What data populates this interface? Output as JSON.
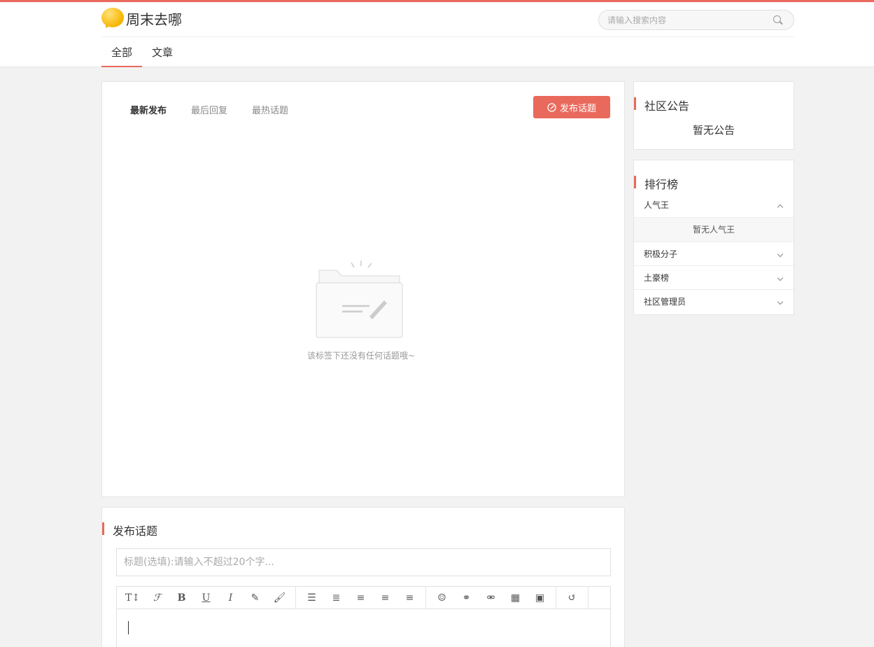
{
  "header": {
    "site_name": "周末去哪",
    "search_placeholder": "请输入搜索内容",
    "nav_tabs": [
      "全部",
      "文章"
    ]
  },
  "main": {
    "sort_tabs": [
      "最新发布",
      "最后回复",
      "最热话题"
    ],
    "post_button": "发布话题",
    "empty_message": "该标签下还没有任何话题哦~"
  },
  "editor": {
    "section_title": "发布话题",
    "title_placeholder": "标题(选填):请输入不超过20个字...",
    "toolbar": [
      [
        "heading-icon",
        "font-icon",
        "bold-icon",
        "underline-icon",
        "italic-icon",
        "pencil-icon",
        "brush-icon"
      ],
      [
        "bullet-list-icon",
        "numbered-list-icon",
        "align-left-icon",
        "align-center-icon",
        "align-right-icon"
      ],
      [
        "emoji-icon",
        "link-icon",
        "unlink-icon",
        "table-icon",
        "image-icon"
      ],
      [
        "undo-icon"
      ]
    ]
  },
  "sidebar": {
    "notice": {
      "title": "社区公告",
      "text": "暂无公告"
    },
    "ranking": {
      "title": "排行榜",
      "items": [
        {
          "label": "人气王",
          "expanded": true,
          "empty_text": "暂无人气王"
        },
        {
          "label": "积极分子",
          "expanded": false
        },
        {
          "label": "土豪榜",
          "expanded": false
        },
        {
          "label": "社区管理员",
          "expanded": false
        }
      ]
    }
  },
  "colors": {
    "accent": "#e9695c",
    "logo": "#f7b500"
  }
}
